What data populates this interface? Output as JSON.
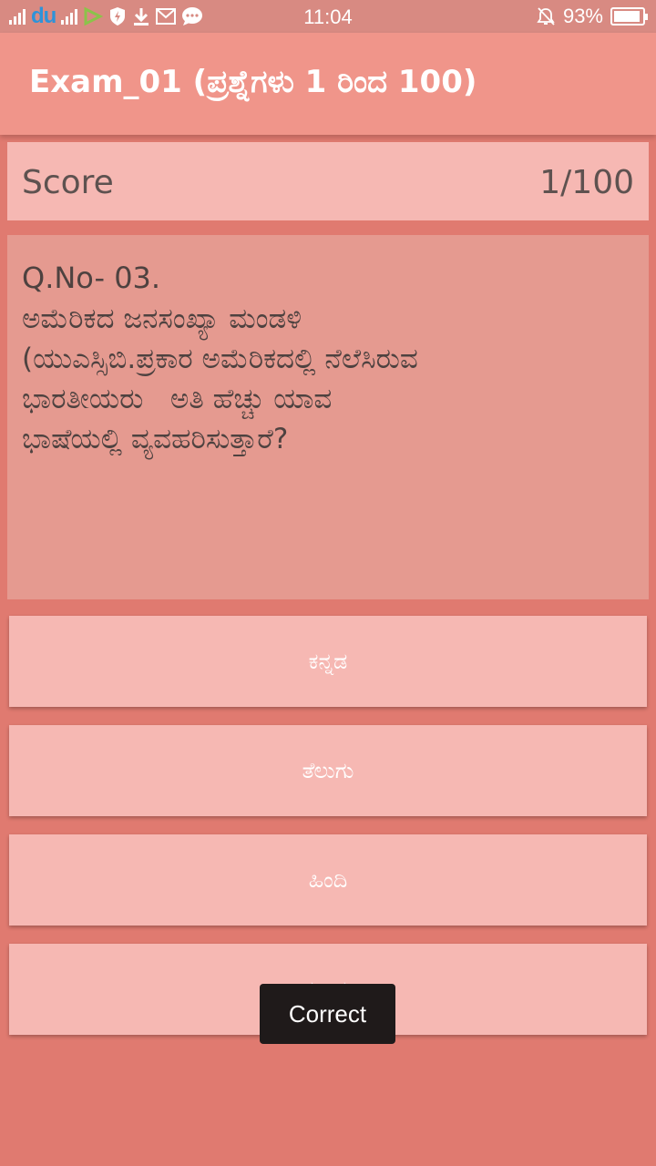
{
  "status_bar": {
    "carrier_logo": "du",
    "time": "11:04",
    "battery_percent": "93%",
    "battery_level": 0.93,
    "icons": [
      "signal-icon",
      "du-logo-icon",
      "signal-icon",
      "etisalat-icon",
      "shield-icon",
      "download-icon",
      "gmail-icon",
      "chat-icon",
      "silent-bell-icon",
      "battery-icon"
    ]
  },
  "app_bar": {
    "title": "Exam_01 (ಪ್ರಶ್ನೆಗಳು 1 ರಿಂದ 100)"
  },
  "score": {
    "label": "Score",
    "value": "1/100"
  },
  "question": {
    "number": "Q.No- 03.",
    "text": "ಅಮೆರಿಕದ ಜನಸಂಖ್ಯಾ ಮಂಡಳಿ\n(ಯುಎಸ್ಸಿಬಿ.ಪ್ರಕಾರ ಅಮೆರಿಕದಲ್ಲಿ ನೆಲೆಸಿರುವ\nಭಾರತೀಯರು   ಅತಿ ಹೆಚ್ಚು ಯಾವ\nಭಾಷೆಯಲ್ಲಿ ವ್ಯವಹರಿಸುತ್ತಾರೆ?"
  },
  "options": [
    {
      "label": "ಕನ್ನಡ"
    },
    {
      "label": "ತೆಲುಗು"
    },
    {
      "label": "ಹಿಂದಿ"
    },
    {
      "label": "ತಮಿಳು"
    }
  ],
  "toast": {
    "message": "Correct"
  },
  "colors": {
    "status_bar": "#d88a82",
    "app_bar": "#f0958a",
    "background": "#e07a70",
    "card": "#f6b8b3",
    "question_card": "#e59a90",
    "toast": "#1f1a1a"
  }
}
